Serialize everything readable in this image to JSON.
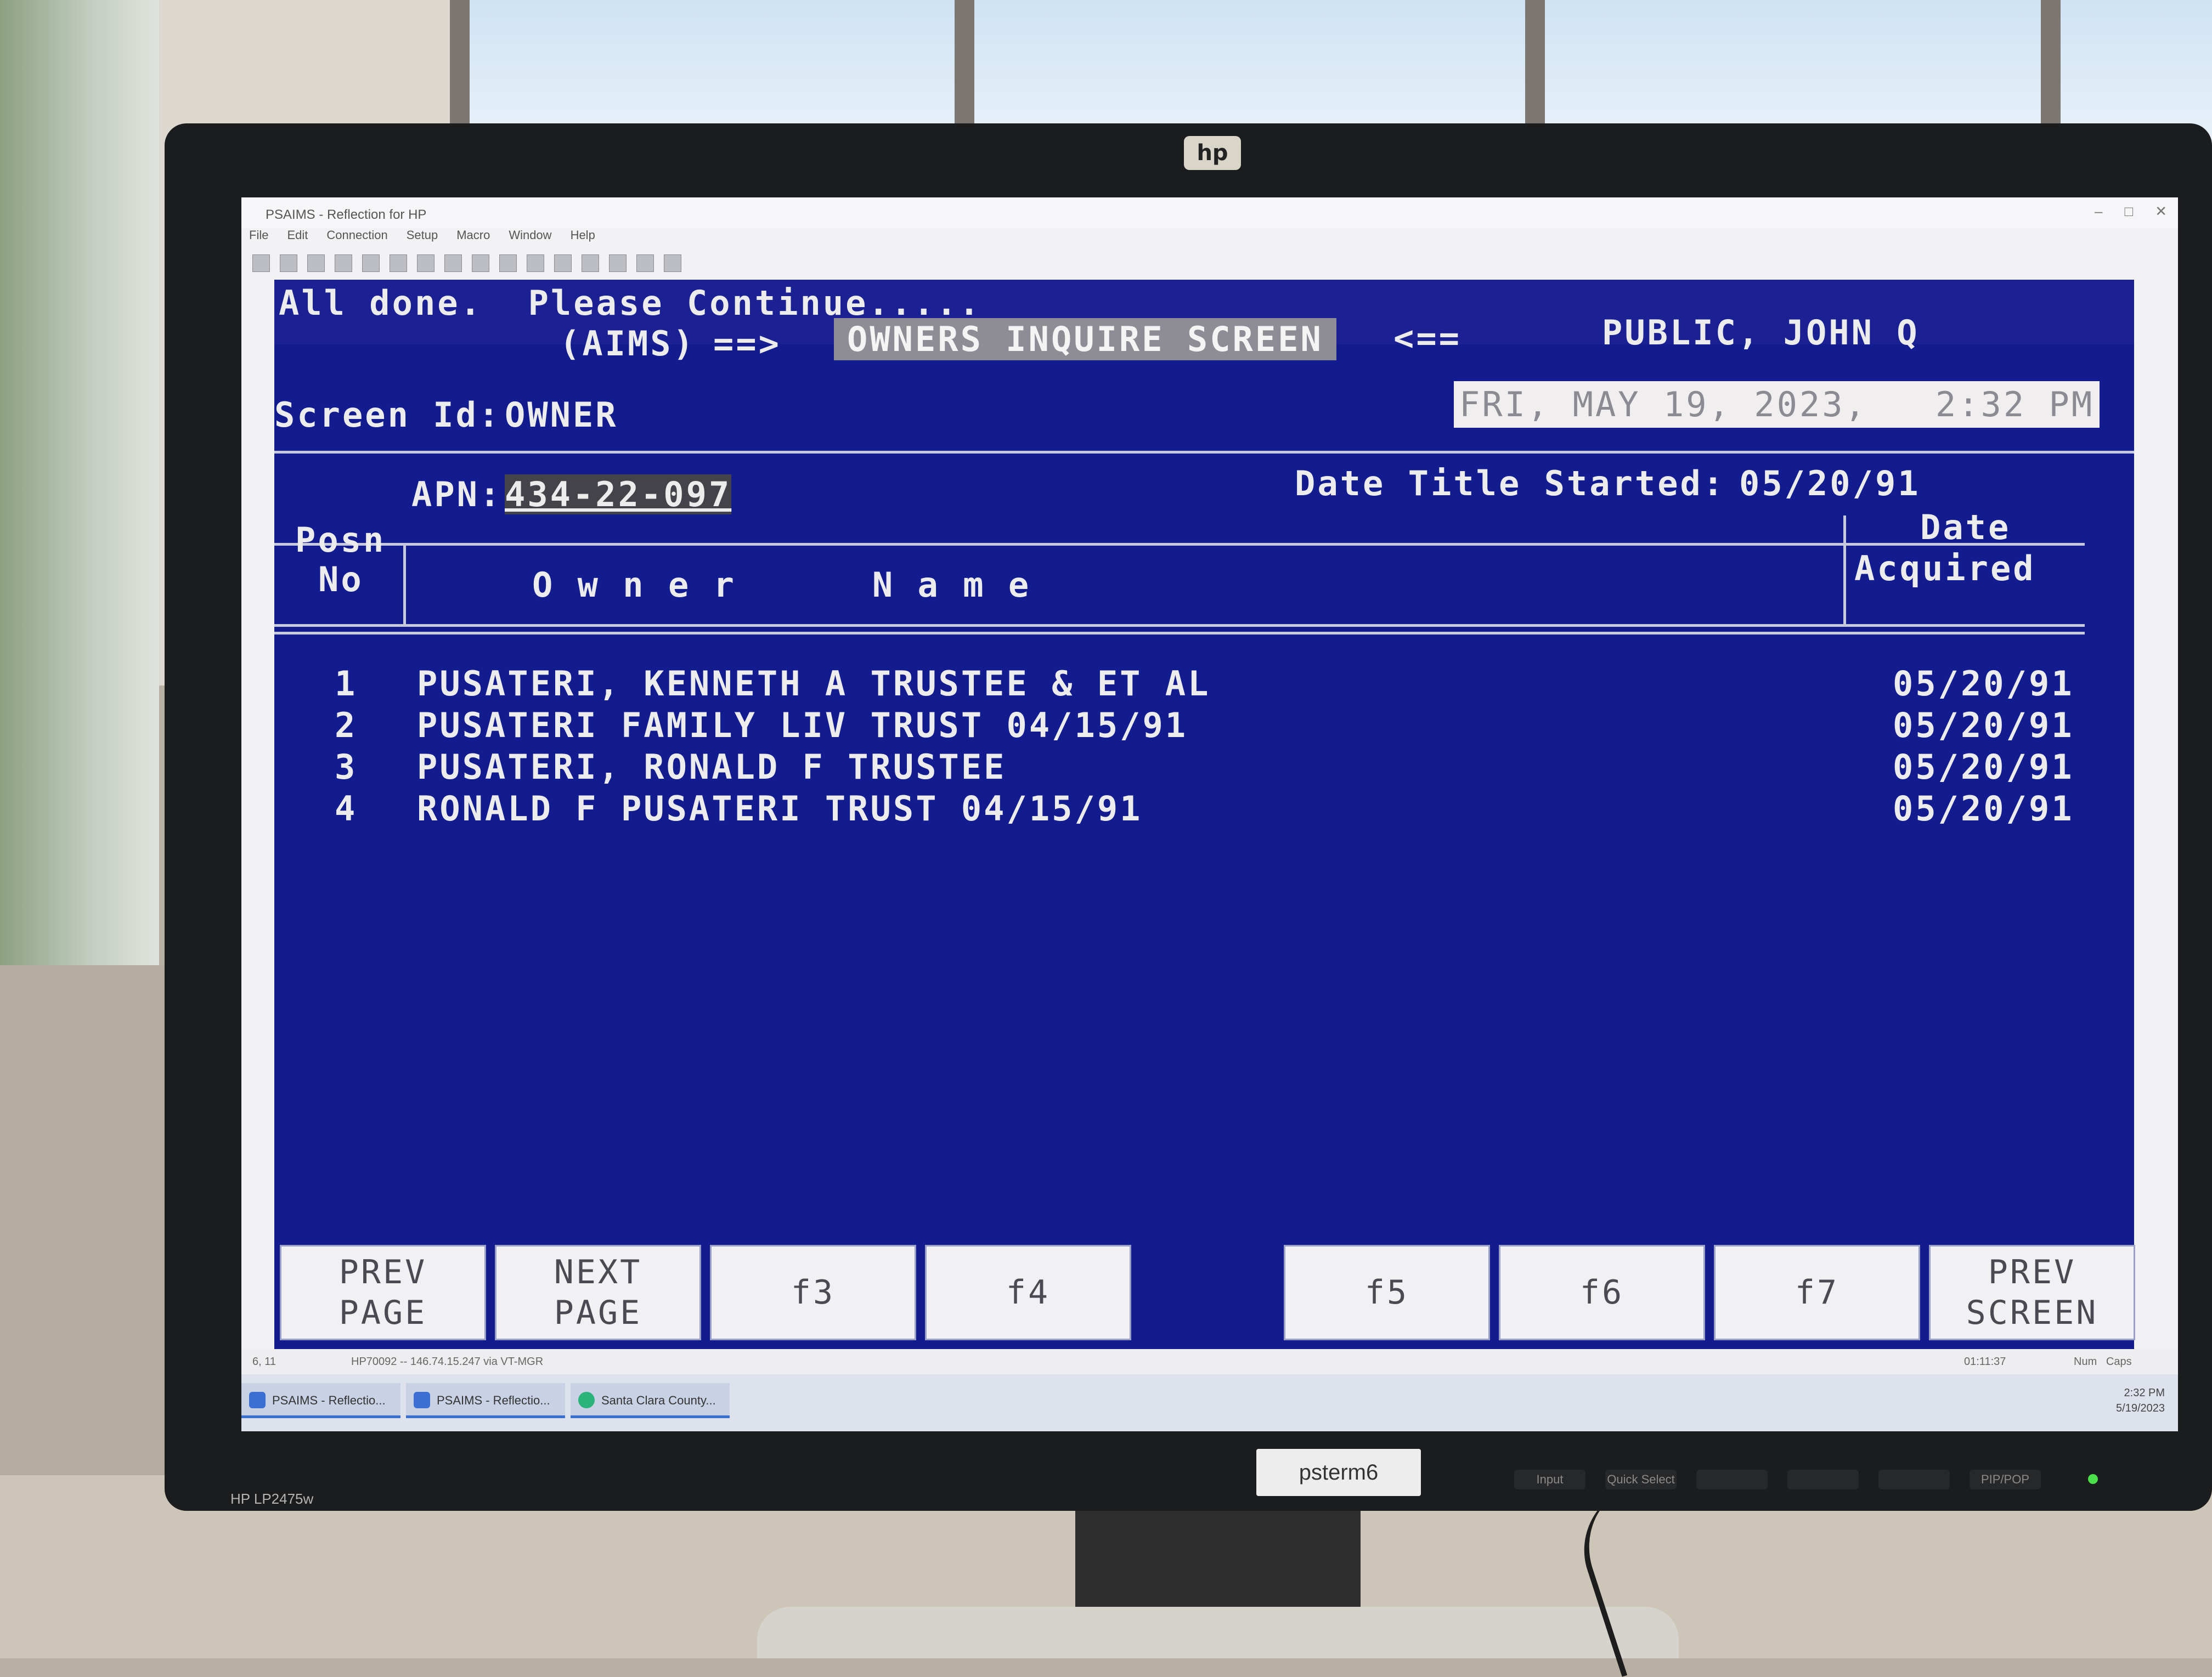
{
  "monitor": {
    "brand_logo": "hp",
    "model": "HP LP2475w",
    "asset_tag": "psterm6",
    "osd_buttons": [
      "Input",
      "Quick Select",
      "",
      "",
      "",
      "PIP/POP"
    ]
  },
  "app": {
    "title": "PSAIMS - Reflection for HP",
    "menu": [
      "File",
      "Edit",
      "Connection",
      "Setup",
      "Macro",
      "Window",
      "Help"
    ],
    "window_controls": [
      "–",
      "□",
      "✕"
    ]
  },
  "terminal": {
    "status_message": "All done.  Please Continue.....",
    "system_label": "(AIMS)",
    "arrow_right": "==>",
    "screen_title": "OWNERS INQUIRE SCREEN",
    "arrow_left": "<==",
    "user_name": "PUBLIC, JOHN Q",
    "screen_id_label": "Screen Id:",
    "screen_id": "OWNER",
    "datetime": "FRI, MAY 19, 2023,   2:32 PM",
    "apn_label": "APN:",
    "apn": "434-22-097",
    "date_title_started_label": "Date Title Started:",
    "date_title_started": "05/20/91",
    "columns": {
      "posn_line1": "Posn",
      "posn_line2": "No",
      "owner_name": "O w n e r      N a m e",
      "date_line1": "Date",
      "date_line2": "Acquired"
    },
    "owners": [
      {
        "posn": "1",
        "name": "PUSATERI, KENNETH A TRUSTEE & ET AL",
        "date_acquired": "05/20/91"
      },
      {
        "posn": "2",
        "name": "PUSATERI FAMILY LIV TRUST 04/15/91",
        "date_acquired": "05/20/91"
      },
      {
        "posn": "3",
        "name": "PUSATERI, RONALD F TRUSTEE",
        "date_acquired": "05/20/91"
      },
      {
        "posn": "4",
        "name": "RONALD F PUSATERI TRUST 04/15/91",
        "date_acquired": "05/20/91"
      }
    ],
    "function_keys": [
      {
        "line1": "PREV",
        "line2": "PAGE"
      },
      {
        "line1": "NEXT",
        "line2": "PAGE"
      },
      {
        "line1": "f3",
        "line2": ""
      },
      {
        "line1": "f4",
        "line2": ""
      },
      {
        "line1": "f5",
        "line2": ""
      },
      {
        "line1": "f6",
        "line2": ""
      },
      {
        "line1": "f7",
        "line2": ""
      },
      {
        "line1": "PREV",
        "line2": "SCREEN"
      }
    ]
  },
  "statusbar": {
    "left": "6, 11",
    "connection": "HP70092 -- 146.74.15.247 via VT-MGR",
    "time": "01:11:37",
    "indicators": "Num   Caps"
  },
  "taskbar": {
    "tasks": [
      "PSAIMS - Reflectio...",
      "PSAIMS - Reflectio...",
      "Santa Clara County..."
    ],
    "clock_time": "2:32 PM",
    "clock_date": "5/19/2023"
  },
  "colors": {
    "terminal_bg": "#131c8e",
    "terminal_text": "#ececec",
    "highlight_bg": "#8e8c95",
    "bezel": "#1b1c1e"
  }
}
